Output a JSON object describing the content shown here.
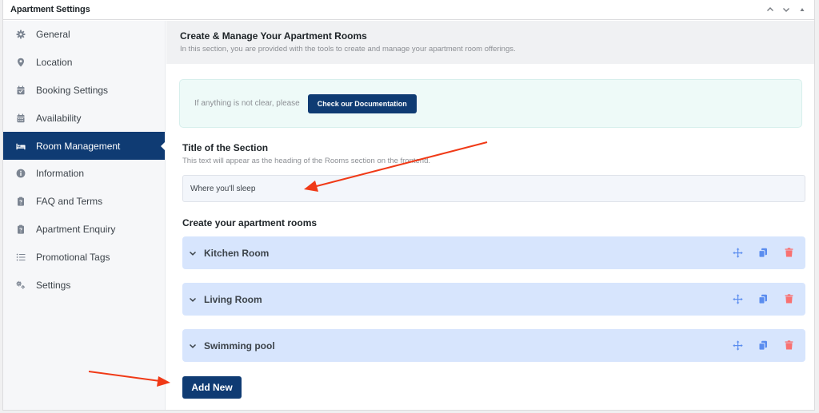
{
  "panel": {
    "title": "Apartment Settings",
    "controls": [
      "move-up",
      "move-down",
      "collapse"
    ]
  },
  "sidebar": {
    "active_index": 4,
    "items": [
      {
        "label": "General",
        "icon": "gear-icon"
      },
      {
        "label": "Location",
        "icon": "map-pin-icon"
      },
      {
        "label": "Booking Settings",
        "icon": "calendar-check-icon"
      },
      {
        "label": "Availability",
        "icon": "calendar-icon"
      },
      {
        "label": "Room Management",
        "icon": "bed-icon"
      },
      {
        "label": "Information",
        "icon": "info-circle-icon"
      },
      {
        "label": "FAQ and Terms",
        "icon": "clipboard-question-icon"
      },
      {
        "label": "Apartment Enquiry",
        "icon": "clipboard-question-icon"
      },
      {
        "label": "Promotional Tags",
        "icon": "list-icon"
      },
      {
        "label": "Settings",
        "icon": "gears-icon"
      }
    ]
  },
  "main": {
    "title": "Create & Manage Your Apartment Rooms",
    "subtitle": "In this section, you are provided with the tools to create and manage your apartment room offerings.",
    "doc_notice": {
      "text": "If anything is not clear, please",
      "button_label": "Check our Documentation"
    },
    "section_title_field": {
      "label": "Title of the Section",
      "help": "This text will appear as the heading of the Rooms section on the frontend.",
      "value": "Where you'll sleep"
    },
    "rooms_label": "Create your apartment rooms",
    "rooms": [
      {
        "name": "Kitchen Room"
      },
      {
        "name": "Living Room"
      },
      {
        "name": "Swimming pool"
      }
    ],
    "add_button_label": "Add New"
  },
  "colors": {
    "primary": "#0f3b73",
    "room_bg": "#d7e5fd",
    "action_blue": "#5b8def",
    "delete_red": "#f87171",
    "notice_bg": "#eefaf8",
    "annotation_arrow": "#f03a17"
  }
}
